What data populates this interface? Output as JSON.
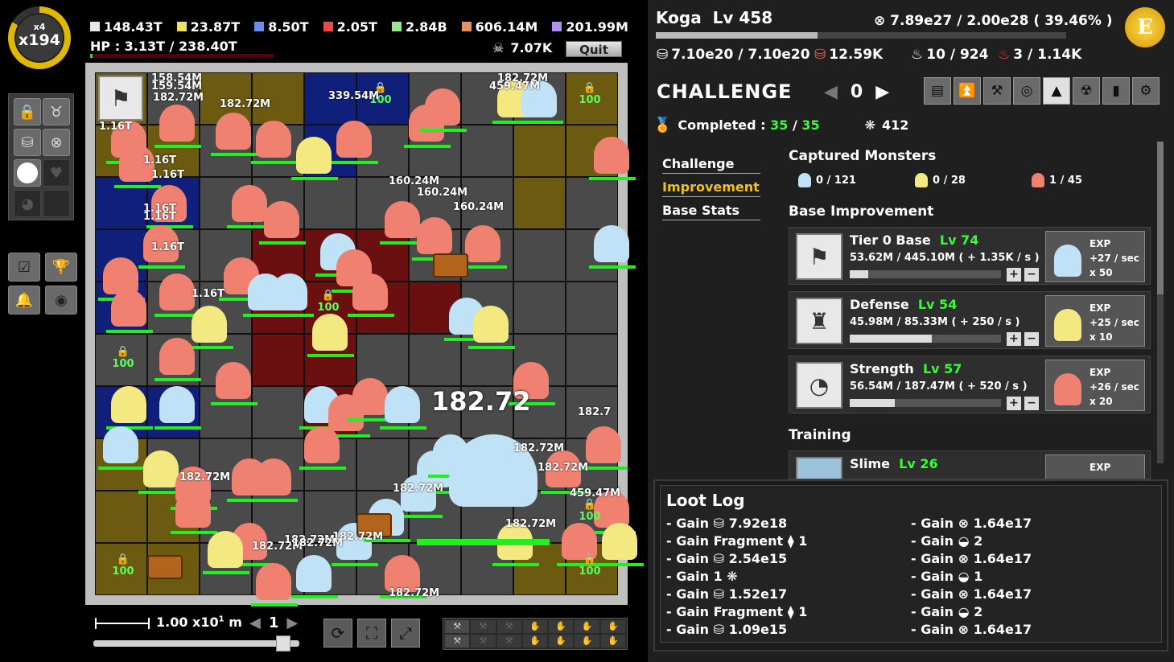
{
  "multiplier": {
    "small": "x4",
    "big": "x194"
  },
  "resources": [
    {
      "value": "148.43T",
      "color": "#e8e8e8"
    },
    {
      "value": "23.87T",
      "color": "#f0e060"
    },
    {
      "value": "8.50T",
      "color": "#6a8cf0"
    },
    {
      "value": "2.05T",
      "color": "#f04848"
    },
    {
      "value": "2.84B",
      "color": "#98e890"
    },
    {
      "value": "606.14M",
      "color": "#e89060"
    },
    {
      "value": "201.99M",
      "color": "#b090f0"
    }
  ],
  "hp": {
    "text": "HP : 3.13T / 238.40T",
    "fraction": 0.013
  },
  "kills": {
    "icon": "skull-icon",
    "value": "7.07K"
  },
  "quit_label": "Quit",
  "map": {
    "lock_labels": [
      "100",
      "100",
      "100",
      "100",
      "100",
      "100",
      "100"
    ],
    "damage_numbers": [
      "158.54M",
      "159.54M",
      "182.72M",
      "182.72M",
      "339.54M",
      "182.72M",
      "459.47M",
      "1.16T",
      "1.16T",
      "1.16T",
      "1.16T",
      "160.24M",
      "160.24M",
      "160.24M",
      "1.16T",
      "1.16T",
      "1.16T",
      "182.72M",
      "182.72M",
      "182.72M",
      "182.72M",
      "182.72M",
      "182.72M",
      "182.72M",
      "182.72M",
      "182.72M",
      "459.47M",
      "182.72M",
      "182.7"
    ],
    "big_damage": "182.72"
  },
  "scale": {
    "base": "1.00 x10",
    "exp": "1",
    "unit": "m",
    "slider": 0.95
  },
  "level_nav": {
    "value": "1"
  },
  "hero": {
    "name": "Koga",
    "level_label": "Lv 458",
    "xp_text": "7.89e27 / 2.00e28 ( 39.46% )",
    "xp_fraction": 0.3946
  },
  "coin_letter": "E",
  "stats": [
    {
      "icon": "bag-icon",
      "value": "7.10e20 / 7.10e20",
      "color": "#ffffff"
    },
    {
      "icon": "red-bag-icon",
      "value": "12.59K",
      "color": "#ffffff"
    },
    {
      "icon": "flame-icon",
      "value": "10 / 924",
      "color": "#ffffff"
    },
    {
      "icon": "red-flame-icon",
      "value": "3 / 1.14K",
      "color": "#ffffff"
    }
  ],
  "challenge": {
    "title": "CHALLENGE",
    "number": "0"
  },
  "completed": {
    "label": "Completed : ",
    "done": "35",
    "sep": " / ",
    "total": "35",
    "web_count": "412"
  },
  "side_menu": [
    "Challenge",
    "Improvement",
    "Base Stats"
  ],
  "captured": {
    "title": "Captured Monsters",
    "items": [
      {
        "count": "0 / 121",
        "color": "#bfe2f6"
      },
      {
        "count": "0 / 28",
        "color": "#f4e880"
      },
      {
        "count": "1 / 45",
        "color": "#f08070"
      }
    ]
  },
  "base_improvement": {
    "title": "Base Improvement",
    "cards": [
      {
        "name": "Tier 0 Base",
        "level": "Lv 74",
        "value": "53.62M / 445.10M ( + 1.35K / s )",
        "progress": 0.12,
        "exp": [
          "EXP",
          "+27 / sec",
          "x 50"
        ],
        "mon_color": "#bfe2f6",
        "icon": "flag-icon"
      },
      {
        "name": "Defense",
        "level": "Lv 54",
        "value": "45.98M / 85.33M ( + 250 / s )",
        "progress": 0.54,
        "exp": [
          "EXP",
          "+25 / sec",
          "x 10"
        ],
        "mon_color": "#f4e880",
        "icon": "castle-icon"
      },
      {
        "name": "Strength",
        "level": "Lv 57",
        "value": "56.54M / 187.47M ( + 520 / s )",
        "progress": 0.3,
        "exp": [
          "EXP",
          "+26 / sec",
          "x 20"
        ],
        "mon_color": "#f08070",
        "icon": "cannon-icon"
      }
    ]
  },
  "training": {
    "title": "Training",
    "card": {
      "name": "Slime",
      "level": "Lv 26",
      "exp": "EXP"
    }
  },
  "loot_log": {
    "title": "Loot Log",
    "left": [
      "- Gain ⛁ 7.92e18",
      "- Gain Fragment ⧫ 1",
      "- Gain ⛁ 2.54e15",
      "- Gain 1 ❋",
      "- Gain ⛁ 1.52e17",
      "- Gain Fragment ⧫ 1",
      "- Gain ⛁ 1.09e15"
    ],
    "right": [
      "- Gain ⊗ 1.64e17",
      "- Gain ◒ 2",
      "- Gain ⊗ 1.64e17",
      "- Gain ◒ 1",
      "- Gain ⊗ 1.64e17",
      "- Gain ◒ 2",
      "- Gain ⊗ 1.64e17"
    ]
  }
}
